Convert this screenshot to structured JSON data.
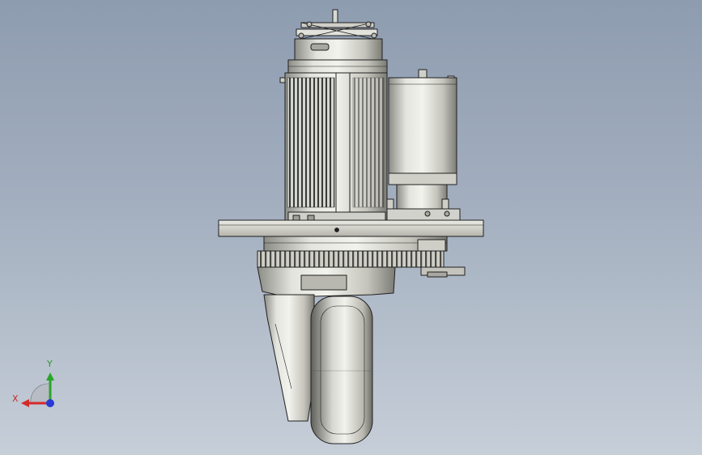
{
  "triad": {
    "y_label": "Y",
    "x_label": "X",
    "colors": {
      "x": "#d42a2a",
      "y": "#2aa52a",
      "z": "#2a3ad6"
    }
  },
  "icons": {
    "triad": "view-orientation-triad-icon"
  },
  "colors": {
    "background_top": "#8e9cb0",
    "background_bottom": "#c6ced8",
    "model": "#d8d8d2",
    "outline": "#202020"
  }
}
